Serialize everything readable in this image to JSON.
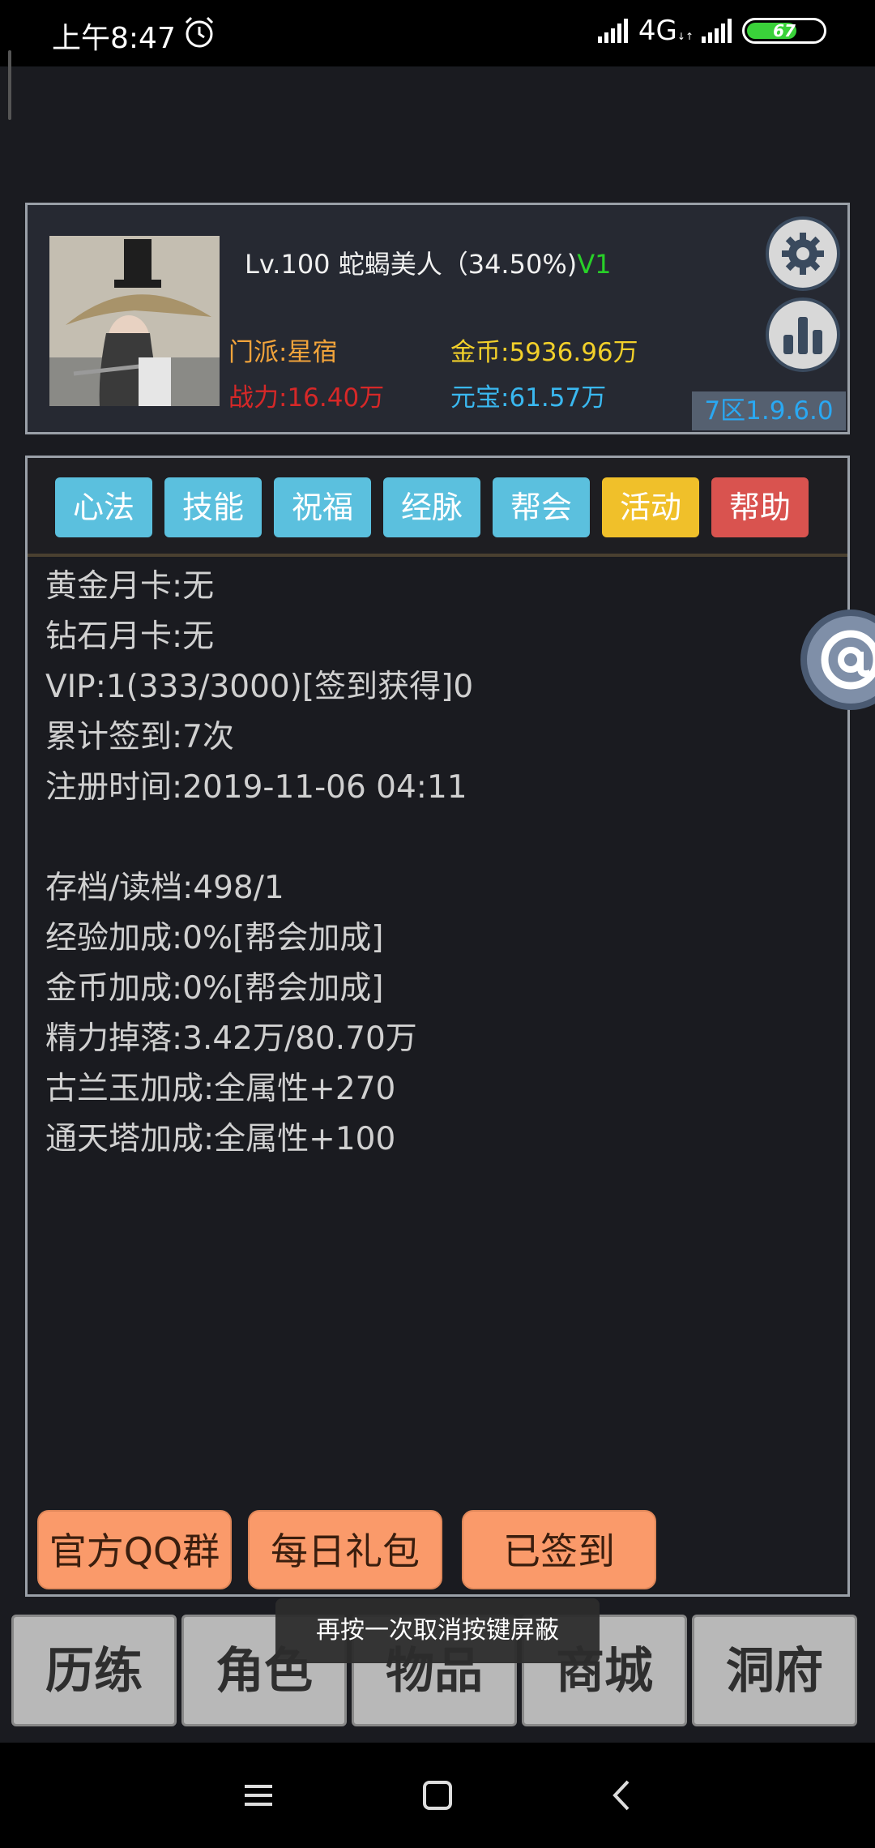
{
  "status_bar": {
    "time": "上午8:47",
    "network": "4G",
    "network_sub": "↓↑",
    "battery": "67"
  },
  "profile": {
    "level_name": "Lv.100 蛇蝎美人（34.50%)",
    "vip": "V1",
    "sect": "门派:星宿",
    "power": "战力:16.40万",
    "gold": "金币:5936.96万",
    "ingot": "元宝:61.57万",
    "version": "7区1.9.6.0"
  },
  "tabs": [
    {
      "label": "心法",
      "color": "#5bc0de"
    },
    {
      "label": "技能",
      "color": "#5bc0de"
    },
    {
      "label": "祝福",
      "color": "#5bc0de"
    },
    {
      "label": "经脉",
      "color": "#5bc0de"
    },
    {
      "label": "帮会",
      "color": "#5bc0de"
    },
    {
      "label": "活动",
      "color": "#f0c02a"
    },
    {
      "label": "帮助",
      "color": "#d9534f"
    }
  ],
  "info_lines": [
    "黄金月卡:无",
    "钻石月卡:无",
    "VIP:1(333/3000)[签到获得]0",
    "累计签到:7次",
    "注册时间:2019-11-06 04:11",
    "",
    "存档/读档:498/1",
    "经验加成:0%[帮会加成]",
    "金币加成:0%[帮会加成]",
    "精力掉落:3.42万/80.70万",
    "古兰玉加成:全属性+270",
    "通天塔加成:全属性+100"
  ],
  "actions": [
    "官方QQ群",
    "每日礼包",
    "已签到"
  ],
  "bottom_nav": [
    "历练",
    "角色",
    "物品",
    "商城",
    "洞府"
  ],
  "toast": "再按一次取消按键屏蔽"
}
